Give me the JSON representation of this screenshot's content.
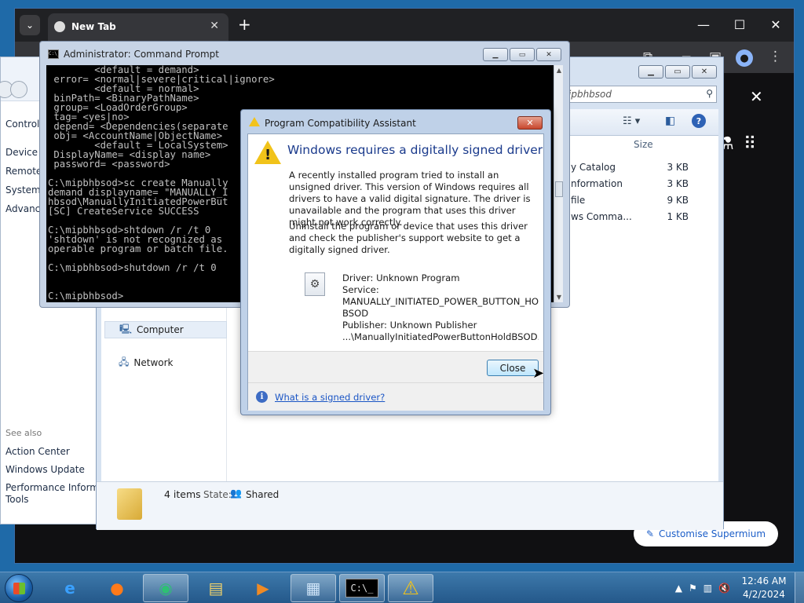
{
  "browser": {
    "tab_title": "New Tab",
    "tab_menu_icon": "chevron-down-icon",
    "customise_label": "Customise Supermium"
  },
  "explorer": {
    "left_links": [
      "Control",
      "Device M",
      "Remote",
      "System p",
      "Advance"
    ],
    "see_also": "See also",
    "see_also_links": [
      "Action Center",
      "Windows Update",
      "Performance Informat",
      "Tools"
    ],
    "search_placeholder": "ipbhbsod",
    "size_header": "Size",
    "files": [
      {
        "name": "y Catalog",
        "size": "3 KB"
      },
      {
        "name": "nformation",
        "size": "3 KB"
      },
      {
        "name": "file",
        "size": "9 KB"
      },
      {
        "name": "ws Comma...",
        "size": "1 KB"
      }
    ],
    "nav": {
      "computer": "Computer",
      "network": "Network"
    },
    "status": {
      "items": "4 items",
      "state_label": "State:",
      "state_value": "Shared"
    }
  },
  "cmd": {
    "title": "Administrator: Command Prompt",
    "icon_text": "C:\\_",
    "lines": [
      "        <default = demand>",
      " error= <normal|severe|critical|ignore>",
      "        <default = normal>",
      " binPath= <BinaryPathName>",
      " group= <LoadOrderGroup>",
      " tag= <yes|no>",
      " depend= <Dependencies(separate",
      " obj= <AccountName|ObjectName>",
      "        <default = LocalSystem>",
      " DisplayName= <display name>",
      " password= <password>",
      "",
      "C:\\mipbhbsod>sc create Manually",
      "demand displayname= \"MANUALLY_I",
      "hbsod\\ManuallyInitiatedPowerBut",
      "[SC] CreateService SUCCESS",
      "",
      "C:\\mipbhbsod>shtdown /r /t 0",
      "'shtdown' is not recognized as",
      "operable program or batch file.",
      "",
      "C:\\mipbhbsod>shutdown /r /t 0",
      "",
      "",
      "C:\\mipbhbsod>"
    ]
  },
  "dialog": {
    "title": "Program Compatibility Assistant",
    "heading": "Windows requires a digitally signed driver",
    "para1": "A recently installed program tried to install an unsigned driver. This version of Windows requires all drivers to have a valid digital signature. The driver is unavailable and the program that uses this driver might not work correctly.",
    "para2": "Uninstall the program or device that uses this driver and check the publisher's support website to get a digitally signed driver.",
    "driver": "Driver: Unknown Program",
    "service_label": "Service:",
    "service_line1": "MANUALLY_INITIATED_POWER_BUTTON_HO",
    "service_line2": "BSOD",
    "publisher": "Publisher: Unknown Publisher",
    "path": "...\\ManuallyInitiatedPowerButtonHoldBSOD.sys",
    "close_label": "Close",
    "help_link": "What is a signed driver?"
  },
  "taskbar": {
    "time": "12:46 AM",
    "date": "4/2/2024",
    "apps": [
      "internet-explorer-icon",
      "firefox-icon",
      "supermium-icon",
      "explorer-folder-icon",
      "media-player-icon",
      "control-panel-icon",
      "command-prompt-icon",
      "warning-icon"
    ]
  },
  "colors": {
    "dialog_heading": "#1a3a8c",
    "link": "#1a55c5",
    "warning": "#f1c31a",
    "taskbar": "#2c6699"
  }
}
